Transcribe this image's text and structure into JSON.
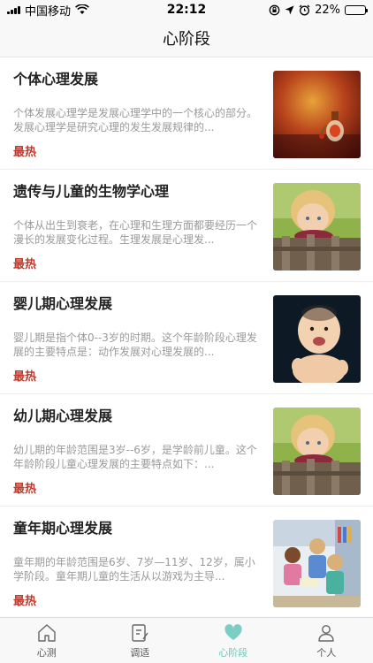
{
  "status": {
    "carrier": "中国移动",
    "time": "22:12",
    "battery_percent": "22%",
    "battery_level": 0.22
  },
  "nav": {
    "title": "心阶段"
  },
  "articles": [
    {
      "title": "个体心理发展",
      "desc": "个体发展心理学是发展心理学中的一个核心的部分。发展心理学是研究心理的发生发展规律的...",
      "tag": "最热",
      "thumb": "bottle-on-red-background"
    },
    {
      "title": "遗传与儿童的生物学心理",
      "desc": "个体从出生到衰老，在心理和生理方面都要经历一个漫长的发展变化过程。生理发展是心理发...",
      "tag": "最热",
      "thumb": "toddler-at-fence"
    },
    {
      "title": "婴儿期心理发展",
      "desc": "婴儿期是指个体0--3岁的时期。这个年龄阶段心理发展的主要特点是：动作发展对心理发展的...",
      "tag": "最热",
      "thumb": "laughing-baby"
    },
    {
      "title": "幼儿期心理发展",
      "desc": "幼儿期的年龄范围是3岁--6岁，是学龄前儿童。这个年龄阶段儿童心理发展的主要特点如下：...",
      "tag": "最热",
      "thumb": "toddler-at-fence"
    },
    {
      "title": "童年期心理发展",
      "desc": "童年期的年龄范围是6岁、7岁—11岁、12岁，属小学阶段。童年期儿童的生活从以游戏为主导...",
      "tag": "最热",
      "thumb": "children-reading"
    }
  ],
  "tabs": [
    {
      "label": "心测",
      "icon": "home-icon",
      "active": false
    },
    {
      "label": "调适",
      "icon": "notes-icon",
      "active": false
    },
    {
      "label": "心阶段",
      "icon": "heart-icon",
      "active": true
    },
    {
      "label": "个人",
      "icon": "person-icon",
      "active": false
    }
  ],
  "colors": {
    "accent": "#6cc3b9",
    "tag": "#c0392b"
  }
}
